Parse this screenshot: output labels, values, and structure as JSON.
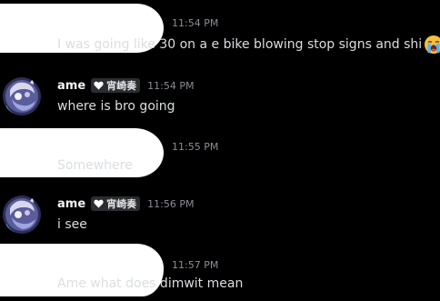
{
  "messages": [
    {
      "author": "",
      "tag": "",
      "time": "11:54 PM",
      "text": "I was going like 30 on a e bike blowing stop signs and shi",
      "emoji": "loudly-crying-face"
    },
    {
      "author": "ame",
      "tag": "宵崎奏",
      "time": "11:54 PM",
      "text": "where is bro going"
    },
    {
      "author": "",
      "tag": "",
      "time": "11:55 PM",
      "text": "Somewhere"
    },
    {
      "author": "ame",
      "tag": "宵崎奏",
      "time": "11:56 PM",
      "text": "i see"
    },
    {
      "author": "",
      "tag": "",
      "time": "11:57 PM",
      "text": "Ame what does dimwit mean"
    }
  ],
  "colors": {
    "background": "#000000",
    "message_text": "#dbdee1",
    "author_name": "#f2f3f5",
    "timestamp": "#8a8e96",
    "tag_background": "#2b2d31"
  }
}
